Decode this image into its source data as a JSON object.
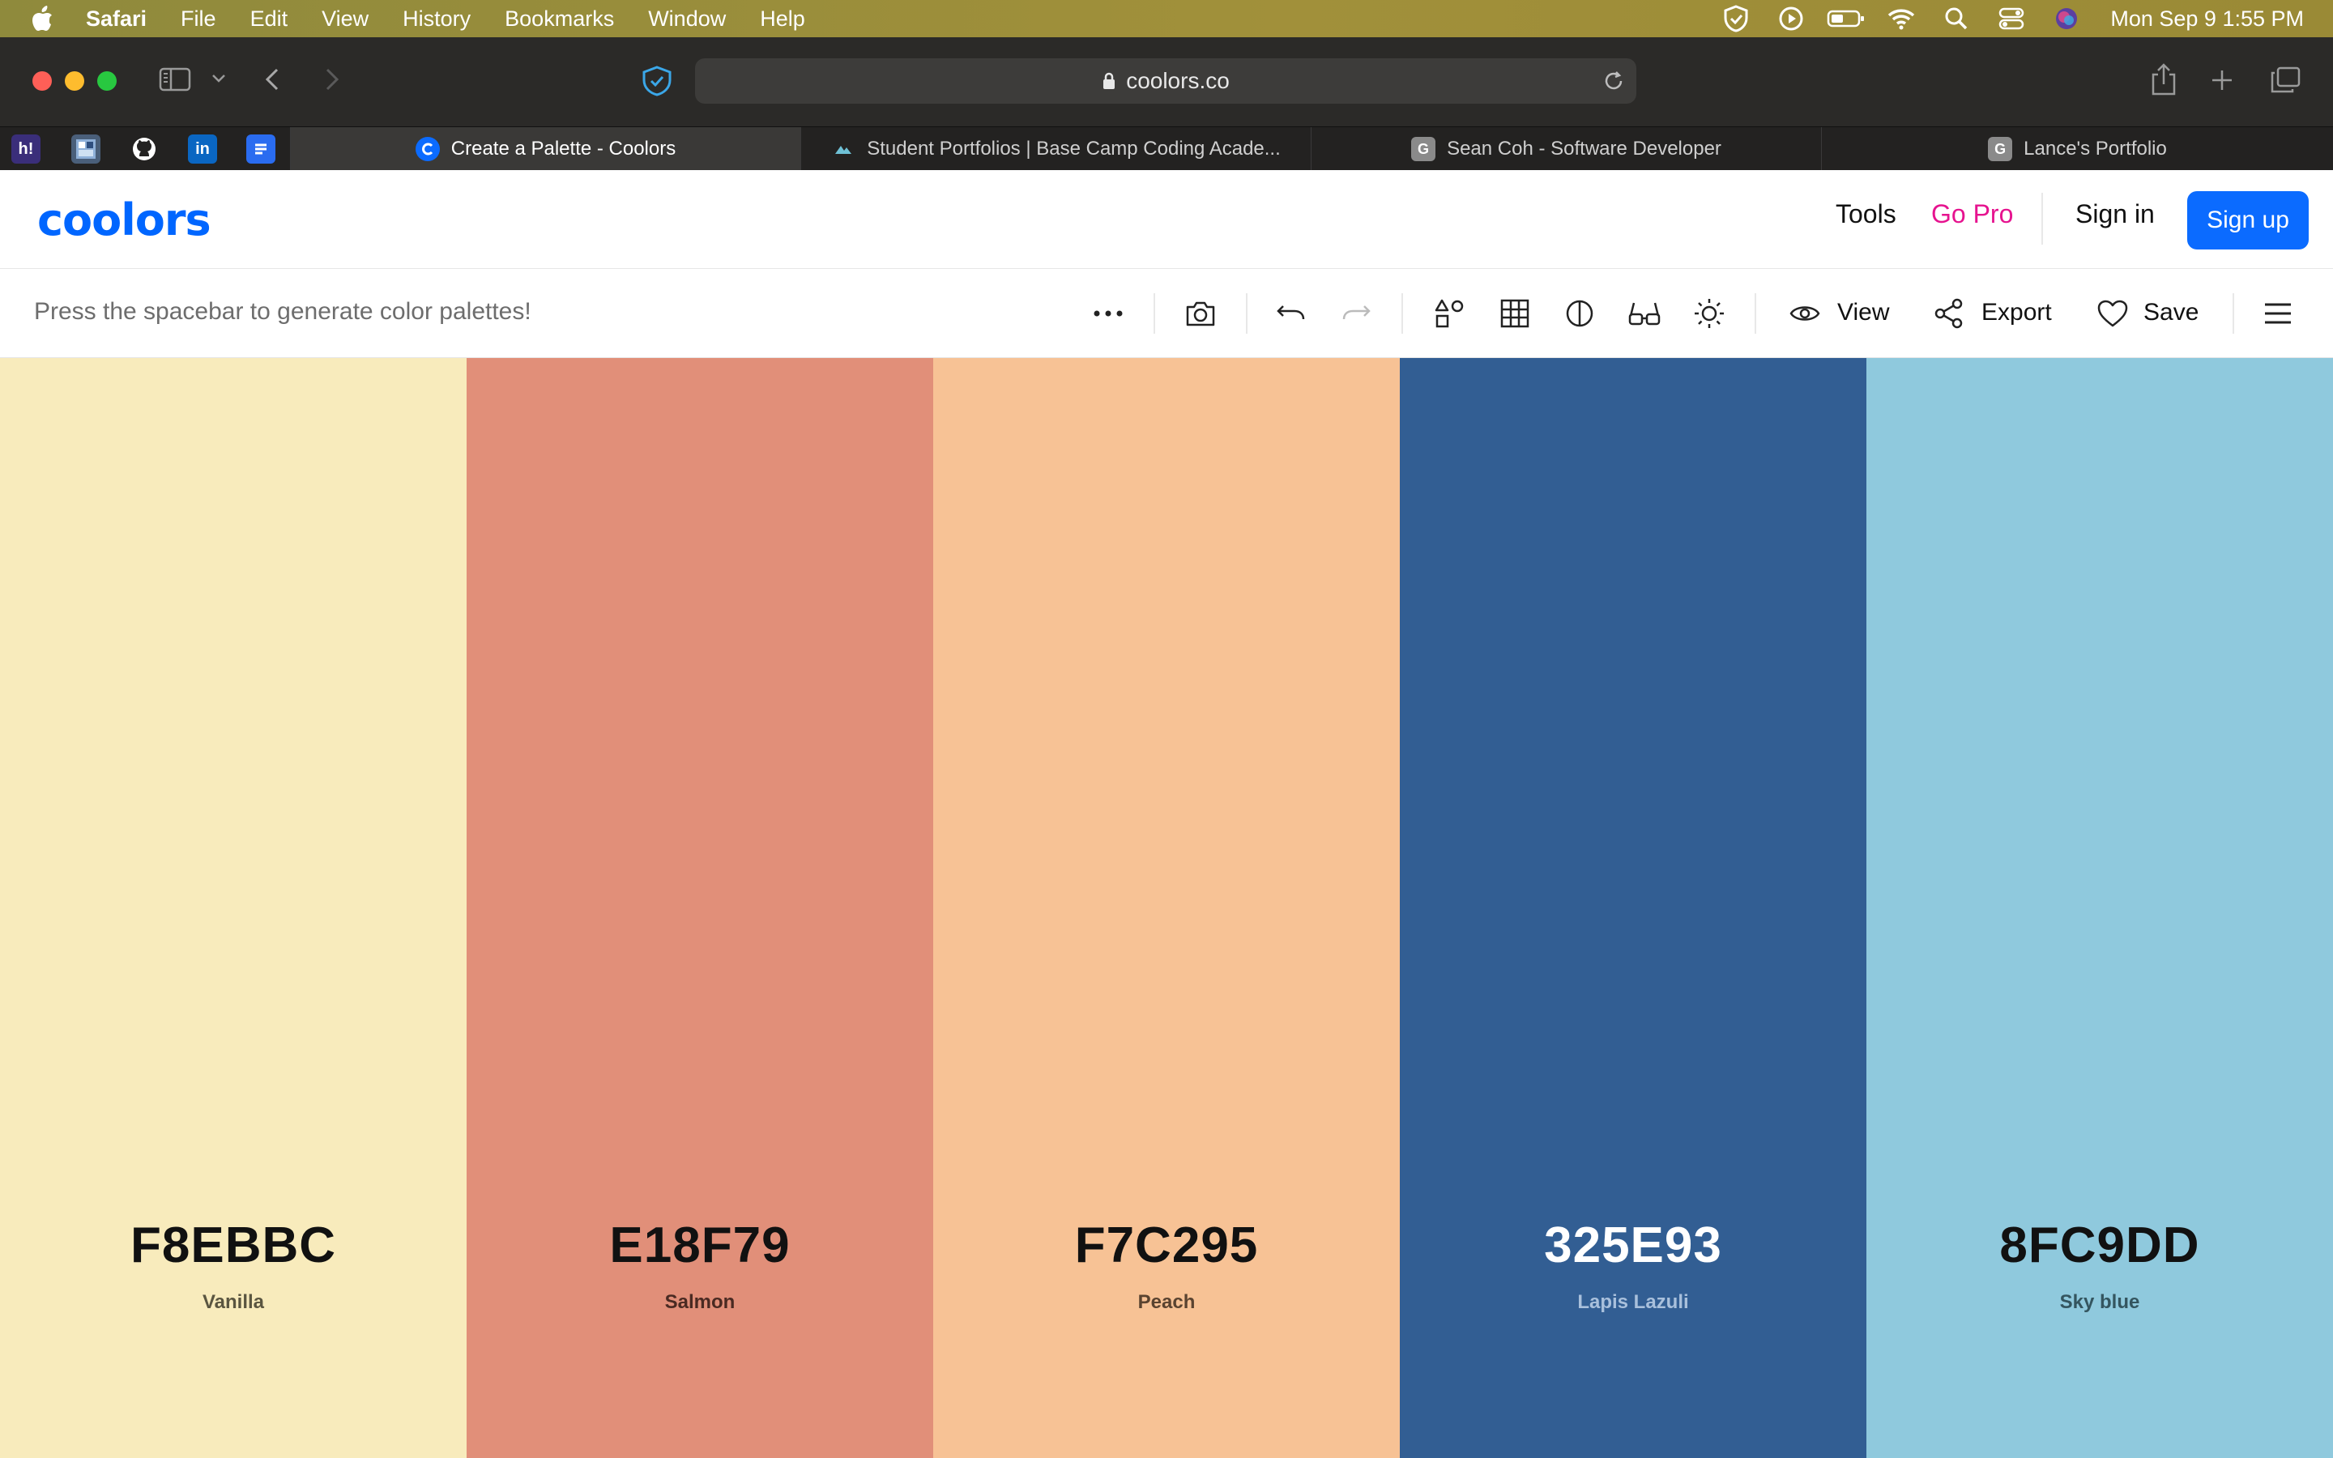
{
  "menubar": {
    "app": "Safari",
    "items": [
      "File",
      "Edit",
      "View",
      "History",
      "Bookmarks",
      "Window",
      "Help"
    ],
    "clock": "Mon Sep 9  1:55 PM"
  },
  "browser": {
    "url": "coolors.co",
    "tabs": [
      {
        "label": "Create a Palette - Coolors",
        "active": true
      },
      {
        "label": "Student Portfolios | Base Camp Coding Acade...",
        "active": false
      },
      {
        "label": "Sean Coh - Software Developer",
        "active": false
      },
      {
        "label": "Lance's Portfolio",
        "active": false
      }
    ],
    "favorites": [
      {
        "name": "hackernoon-favicon",
        "glyph": "h!",
        "color": "#3a2e7a"
      },
      {
        "name": "app-favicon",
        "glyph": "",
        "color": "#4a5f7a"
      },
      {
        "name": "github-favicon",
        "glyph": "",
        "color": "#232221"
      },
      {
        "name": "linkedin-favicon",
        "glyph": "in",
        "color": "#0a66c2"
      },
      {
        "name": "google-docs-favicon",
        "glyph": "",
        "color": "#2a6cf0"
      }
    ]
  },
  "header": {
    "logo": "coolors",
    "nav": {
      "tools": "Tools",
      "gopro": "Go Pro",
      "signin": "Sign in",
      "signup": "Sign up"
    }
  },
  "toolbar": {
    "hint": "Press the spacebar to generate color palettes!",
    "view_label": "View",
    "export_label": "Export",
    "save_label": "Save"
  },
  "palette": [
    {
      "hex": "F8EBBC",
      "name": "Vanilla",
      "bg": "#F8EBBC",
      "text": "#111111",
      "sub": "#5a5540"
    },
    {
      "hex": "E18F79",
      "name": "Salmon",
      "bg": "#E18F79",
      "text": "#111111",
      "sub": "#4a2a22"
    },
    {
      "hex": "F7C295",
      "name": "Peach",
      "bg": "#F7C295",
      "text": "#111111",
      "sub": "#5a4330"
    },
    {
      "hex": "325E93",
      "name": "Lapis Lazuli",
      "bg": "#325E93",
      "text": "#ffffff",
      "sub": "#a9c0dc"
    },
    {
      "hex": "8FC9DD",
      "name": "Sky blue",
      "bg": "#8FC9DD",
      "text": "#111111",
      "sub": "#34555f"
    }
  ],
  "colors": {
    "brand": "#0066FF",
    "gopro": "#E6138F",
    "signup_bg": "#0B6BFF"
  }
}
